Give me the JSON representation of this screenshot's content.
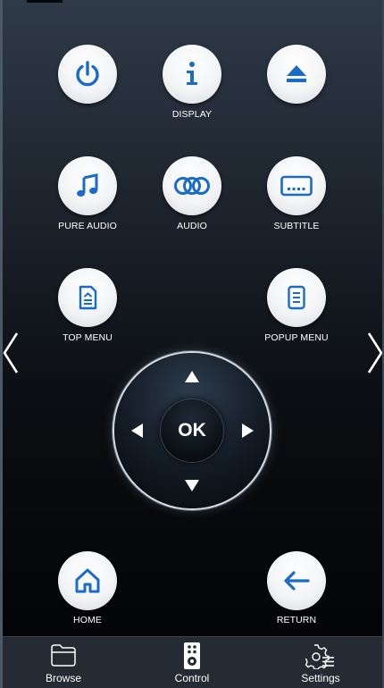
{
  "colors": {
    "accent": "#1b6cc6",
    "button_face": "#f3f4f6",
    "tabbar": "#252b32"
  },
  "remote": {
    "power": {
      "icon": "power-icon",
      "label": ""
    },
    "display": {
      "icon": "info-icon",
      "label": "DISPLAY"
    },
    "eject": {
      "icon": "eject-icon",
      "label": ""
    },
    "pure_audio": {
      "icon": "music-note-icon",
      "label": "PURE AUDIO"
    },
    "audio": {
      "icon": "audio-rings-icon",
      "label": "AUDIO"
    },
    "subtitle": {
      "icon": "subtitle-icon",
      "label": "SUBTITLE"
    },
    "top_menu": {
      "icon": "top-menu-icon",
      "label": "TOP MENU"
    },
    "popup_menu": {
      "icon": "popup-menu-icon",
      "label": "POPUP MENU"
    },
    "home": {
      "icon": "home-icon",
      "label": "HOME"
    },
    "return": {
      "icon": "return-arrow-icon",
      "label": "RETURN"
    }
  },
  "dpad": {
    "ok_label": "OK"
  },
  "nav_arrows": {
    "left": "chevron-left-icon",
    "right": "chevron-right-icon"
  },
  "tabs": [
    {
      "label": "Browse",
      "icon": "folder-icon"
    },
    {
      "label": "Control",
      "icon": "remote-icon"
    },
    {
      "label": "Settings",
      "icon": "settings-icon"
    }
  ]
}
